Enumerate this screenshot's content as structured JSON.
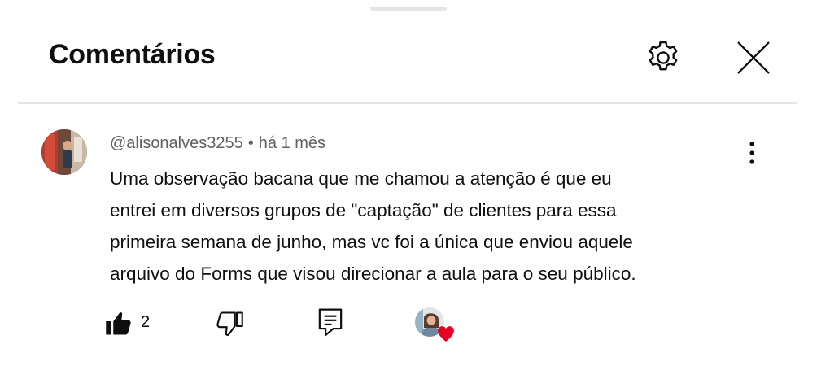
{
  "header": {
    "title": "Comentários",
    "settings_icon": "gear-icon",
    "close_icon": "close-icon"
  },
  "comment": {
    "author": "@alisonalves3255",
    "separator": "•",
    "time": "há 1 mês",
    "text_lines": [
      "Uma observação bacana que me chamou a atenção é que eu",
      "entrei em diversos grupos de \"captação\" de clientes para essa",
      "primeira semana de junho, mas vc foi a única que enviou aquele",
      "arquivo do Forms que visou direcionar a aula para o seu público."
    ],
    "likes": "2",
    "hearted_by_creator": true
  },
  "colors": {
    "text_primary": "#0f0f0f",
    "text_secondary": "#606060",
    "divider": "#e5e5e5",
    "heart": "#e60023"
  }
}
